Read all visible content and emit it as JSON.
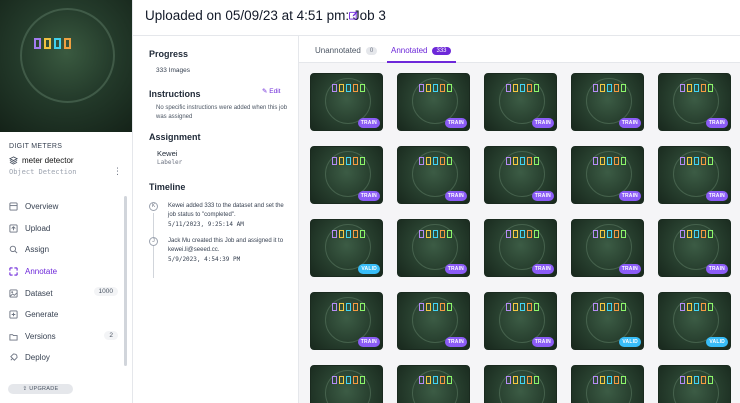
{
  "header": {
    "title": "Uploaded on 05/09/23 at 4:51 pm: Job 3"
  },
  "sidebar": {
    "kicker": "DIGIT METERS",
    "project_name": "meter detector",
    "project_type": "Object Detection",
    "items": [
      {
        "label": "Overview",
        "icon": "overview-icon"
      },
      {
        "label": "Upload",
        "icon": "upload-icon"
      },
      {
        "label": "Assign",
        "icon": "assign-icon"
      },
      {
        "label": "Annotate",
        "icon": "annotate-icon"
      },
      {
        "label": "Dataset",
        "icon": "dataset-icon",
        "count": "1000"
      },
      {
        "label": "Generate",
        "icon": "generate-icon"
      },
      {
        "label": "Versions",
        "icon": "versions-icon",
        "count": "2"
      },
      {
        "label": "Deploy",
        "icon": "deploy-icon"
      }
    ],
    "upgrade_label": "⇪ UPGRADE"
  },
  "details": {
    "progress_title": "Progress",
    "progress_value": "333 Images",
    "instructions_title": "Instructions",
    "instructions_edit": "Edit",
    "instructions_text": "No specific instructions were added when this job was assigned",
    "assignment_title": "Assignment",
    "assignee_name": "Kewei",
    "assignee_role": "Labeler",
    "timeline_title": "Timeline",
    "timeline": [
      {
        "marker": "K",
        "text": "Kewei added 333 to the dataset and set the job status to \"completed\".",
        "time": "5/11/2023, 9:25:14 AM"
      },
      {
        "marker": "J",
        "text": "Jack Mu created this Job and assigned it to kewei.li@seeed.cc.",
        "time": "5/9/2023, 4:54:39 PM"
      }
    ]
  },
  "tabs": [
    {
      "label": "Unannotated",
      "count": "0"
    },
    {
      "label": "Annotated",
      "count": "333"
    }
  ],
  "thumbnails": [
    "TRAIN",
    "TRAIN",
    "TRAIN",
    "TRAIN",
    "TRAIN",
    "TRAIN",
    "TRAIN",
    "TRAIN",
    "TRAIN",
    "TRAIN",
    "VALID",
    "TRAIN",
    "TRAIN",
    "TRAIN",
    "TRAIN",
    "TRAIN",
    "TRAIN",
    "TRAIN",
    "VALID",
    "VALID",
    "",
    "",
    "",
    "",
    ""
  ],
  "colors": {
    "accent": "#6d28d9",
    "train_tag": "#8b5cf6",
    "valid_tag": "#38bdf8"
  }
}
